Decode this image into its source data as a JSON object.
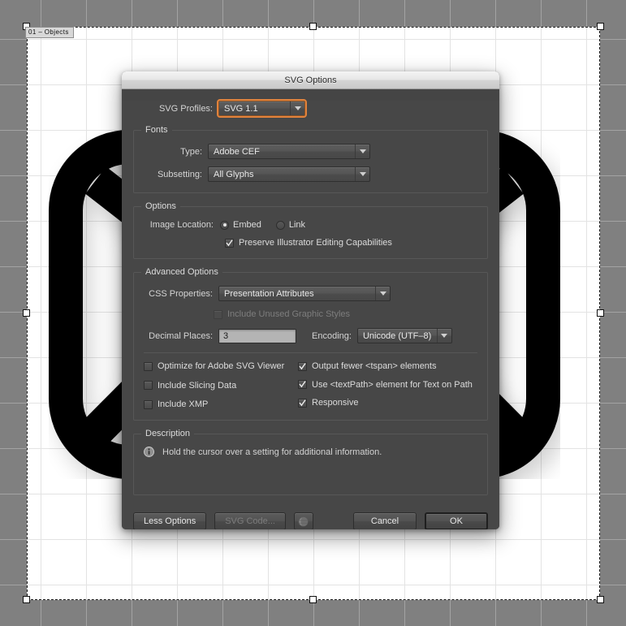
{
  "canvas": {
    "artboard_label": "01 – Objects",
    "background_color": "#808080",
    "artboard_color": "#ffffff",
    "artwork_color": "#000000",
    "artwork_name": "envelope-icon"
  },
  "dialog": {
    "title": "SVG Options",
    "profiles": {
      "label": "SVG Profiles:",
      "value": "SVG 1.1",
      "focused": true
    },
    "fonts": {
      "title": "Fonts",
      "type": {
        "label": "Type:",
        "value": "Adobe CEF"
      },
      "subsetting": {
        "label": "Subsetting:",
        "value": "All Glyphs"
      }
    },
    "options": {
      "title": "Options",
      "image_location": {
        "label": "Image Location:",
        "radios": [
          {
            "label": "Embed",
            "selected": true
          },
          {
            "label": "Link",
            "selected": false
          }
        ]
      },
      "preserve": {
        "label": "Preserve Illustrator Editing Capabilities",
        "checked": true
      }
    },
    "advanced": {
      "title": "Advanced Options",
      "css_properties": {
        "label": "CSS Properties:",
        "value": "Presentation Attributes"
      },
      "include_unused": {
        "label": "Include Unused Graphic Styles",
        "checked": false,
        "disabled": true
      },
      "decimal_places": {
        "label": "Decimal Places:",
        "value": "3"
      },
      "encoding": {
        "label": "Encoding:",
        "value": "Unicode (UTF–8)"
      },
      "checkboxes_left": [
        {
          "label": "Optimize for Adobe SVG Viewer",
          "checked": false
        },
        {
          "label": "Include Slicing Data",
          "checked": false
        },
        {
          "label": "Include XMP",
          "checked": false
        }
      ],
      "checkboxes_right": [
        {
          "label": "Output fewer <tspan> elements",
          "checked": true
        },
        {
          "label": "Use <textPath> element for Text on Path",
          "checked": true
        },
        {
          "label": "Responsive",
          "checked": true
        }
      ]
    },
    "description": {
      "title": "Description",
      "text": "Hold the cursor over a setting for additional information.",
      "icon": "info-icon"
    },
    "footer": {
      "less_options": "Less Options",
      "svg_code": "SVG Code...",
      "svg_code_disabled": true,
      "preview_icon": "globe-icon",
      "cancel": "Cancel",
      "ok": "OK"
    }
  },
  "colors": {
    "dialog_bg": "#474747",
    "focus_orange": "#e2833c",
    "text": "#d4d4d4"
  }
}
